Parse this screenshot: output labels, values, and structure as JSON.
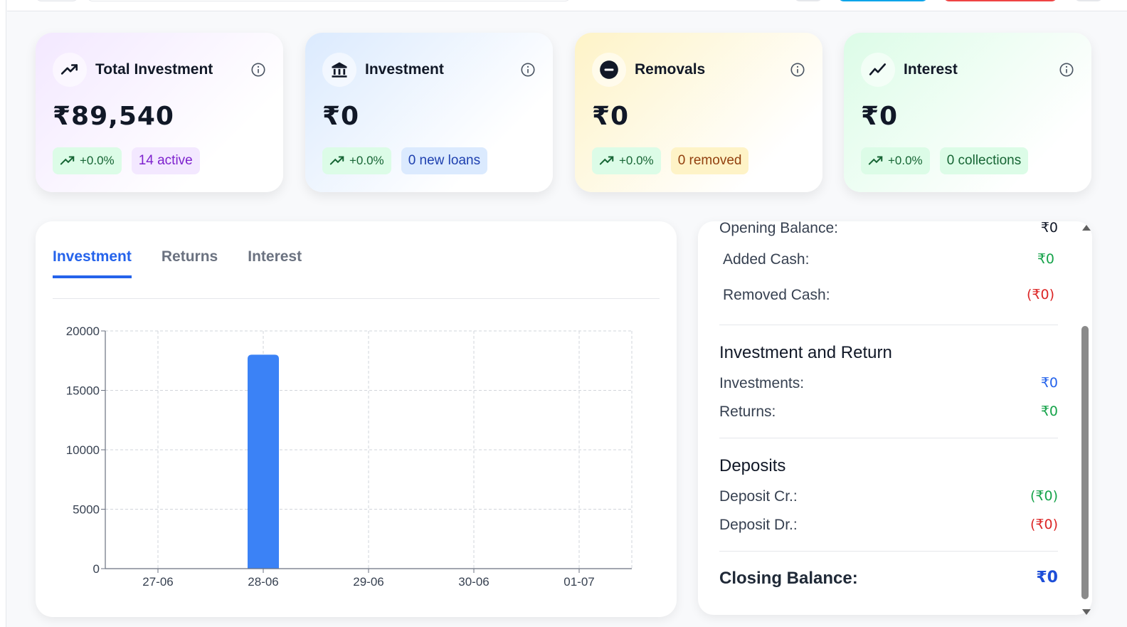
{
  "cards": [
    {
      "title": "Total Investment",
      "icon": "trending-up-icon",
      "value": "₹89,540",
      "growth": "+0.0%",
      "tag": "14 active"
    },
    {
      "title": "Investment",
      "icon": "bank-icon",
      "value": "₹0",
      "growth": "+0.0%",
      "tag": "0 new loans"
    },
    {
      "title": "Removals",
      "icon": "minus-circle-icon",
      "value": "₹0",
      "growth": "+0.0%",
      "tag": "0 removed"
    },
    {
      "title": "Interest",
      "icon": "chart-line-icon",
      "value": "₹0",
      "growth": "+0.0%",
      "tag": "0 collections"
    }
  ],
  "tabs": [
    "Investment",
    "Returns",
    "Interest"
  ],
  "active_tab": "Investment",
  "summary": {
    "opening_balance": {
      "label": "Opening Balance:",
      "value": "₹0"
    },
    "added_cash": {
      "label": "Added Cash:",
      "value": "₹0"
    },
    "removed_cash": {
      "label": "Removed Cash:",
      "value": "(₹0)"
    },
    "investment_return": {
      "title": "Investment and Return",
      "investments": {
        "label": "Investments:",
        "value": "₹0"
      },
      "returns": {
        "label": "Returns:",
        "value": "₹0"
      }
    },
    "deposits": {
      "title": "Deposits",
      "deposit_cr": {
        "label": "Deposit Cr.:",
        "value": "(₹0)"
      },
      "deposit_dr": {
        "label": "Deposit Dr.:",
        "value": "(₹0)"
      }
    },
    "closing_balance": {
      "label": "Closing Balance:",
      "value": "₹0"
    }
  },
  "colors": {
    "accent": "#2563eb",
    "bar": "#3b82f6",
    "positive": "#16a34a",
    "negative": "#dc2626"
  },
  "chart_data": {
    "type": "bar",
    "categories": [
      "27-06",
      "28-06",
      "29-06",
      "30-06",
      "01-07"
    ],
    "values": [
      0,
      18000,
      0,
      0,
      0
    ],
    "ylim": [
      0,
      20000
    ],
    "yticks": [
      0,
      5000,
      10000,
      15000,
      20000
    ],
    "xlabel": "",
    "ylabel": "",
    "grid": true
  }
}
